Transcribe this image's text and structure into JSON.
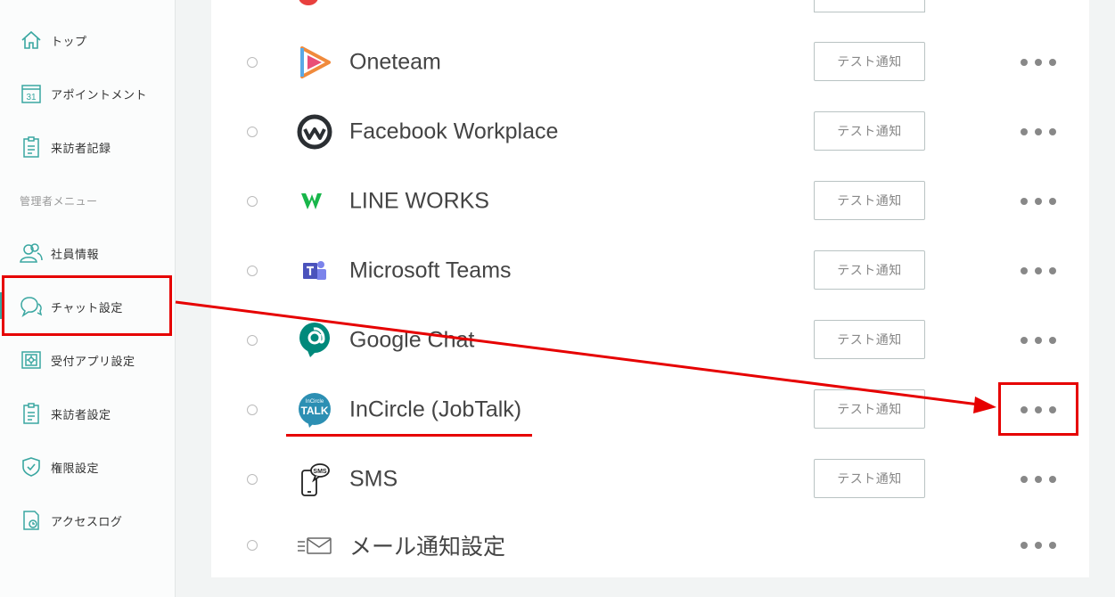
{
  "sidebar": {
    "items": [
      {
        "label": "トップ",
        "icon": "home-icon"
      },
      {
        "label": "アポイントメント",
        "icon": "calendar-icon",
        "icon_text": "31"
      },
      {
        "label": "来訪者記録",
        "icon": "clipboard-icon"
      }
    ],
    "admin_section_label": "管理者メニュー",
    "admin_items": [
      {
        "label": "社員情報",
        "icon": "users-icon"
      },
      {
        "label": "チャット設定",
        "icon": "chat-icon",
        "active": true
      },
      {
        "label": "受付アプリ設定",
        "icon": "tablet-icon"
      },
      {
        "label": "来訪者設定",
        "icon": "clipboard-icon"
      },
      {
        "label": "権限設定",
        "icon": "shield-icon"
      },
      {
        "label": "アクセスログ",
        "icon": "log-icon"
      }
    ]
  },
  "chat_list": {
    "test_button_label": "テスト通知",
    "rows": [
      {
        "name": "Oneteam",
        "icon": "oneteam-logo-icon"
      },
      {
        "name": "Facebook Workplace",
        "icon": "workplace-logo-icon"
      },
      {
        "name": "LINE WORKS",
        "icon": "lineworks-logo-icon"
      },
      {
        "name": "Microsoft Teams",
        "icon": "teams-logo-icon"
      },
      {
        "name": "Google Chat",
        "icon": "googlechat-logo-icon"
      },
      {
        "name": "InCircle (JobTalk)",
        "icon": "incircle-logo-icon",
        "logo_text_small": "InCircle",
        "logo_text_big": "TALK"
      },
      {
        "name": "SMS",
        "icon": "sms-phone-icon",
        "logo_text": "SMS"
      },
      {
        "name": "メール通知設定",
        "icon": "mail-icon"
      }
    ]
  },
  "colors": {
    "accent": "#3aa7a1",
    "annotation_red": "#e60000"
  }
}
